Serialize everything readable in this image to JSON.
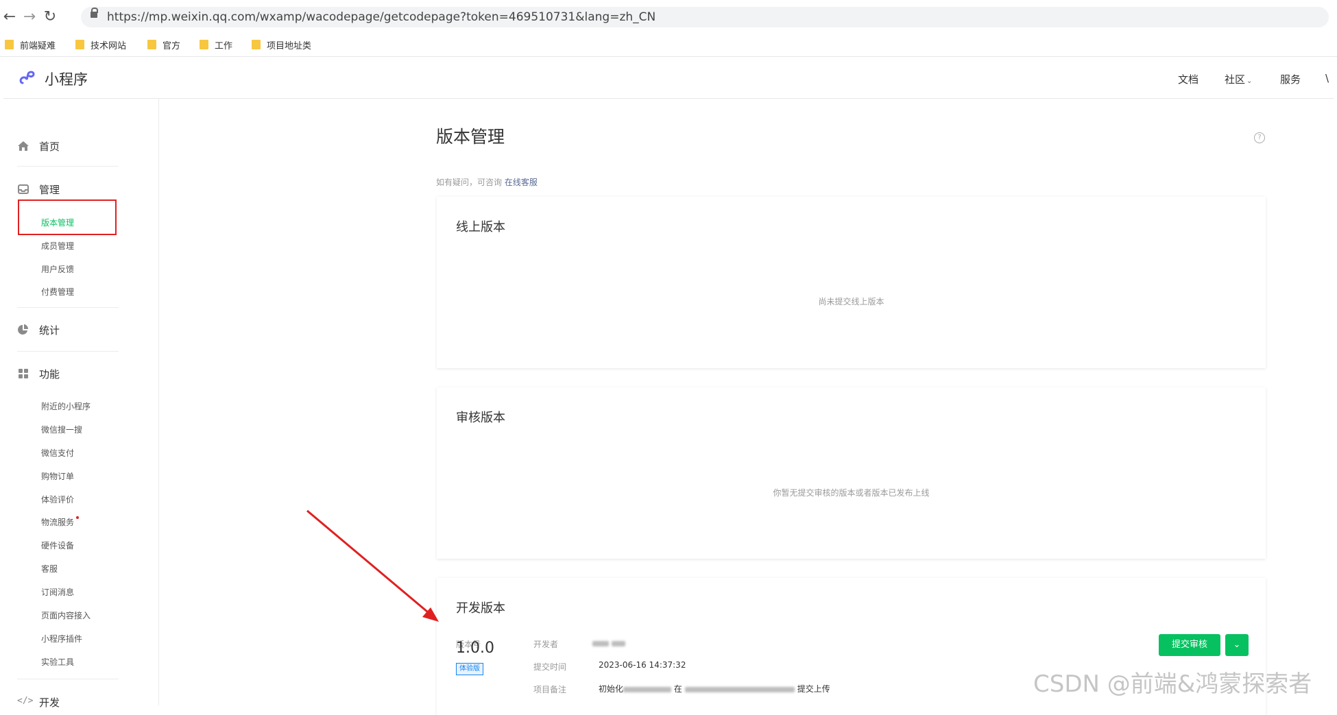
{
  "browser": {
    "url": "https://mp.weixin.qq.com/wxamp/wacodepage/getcodepage?token=469510731&lang=zh_CN",
    "bookmarks": [
      "前端疑难",
      "技术网站",
      "官方",
      "工作",
      "项目地址类"
    ]
  },
  "header": {
    "brand": "小程序",
    "nav": [
      "文档",
      "社区",
      "服务",
      "\\"
    ]
  },
  "sidebar": {
    "home": "首页",
    "manage": {
      "label": "管理",
      "items": [
        "版本管理",
        "成员管理",
        "用户反馈",
        "付费管理"
      ]
    },
    "stats": "统计",
    "features": {
      "label": "功能",
      "items": [
        "附近的小程序",
        "微信搜一搜",
        "微信支付",
        "购物订单",
        "体验评价",
        "物流服务",
        "硬件设备",
        "客服",
        "订阅消息",
        "页面内容接入",
        "小程序插件",
        "实验工具"
      ]
    },
    "dev": "开发"
  },
  "main": {
    "title": "版本管理",
    "tip_text": "如有疑问，可咨询",
    "tip_link": "在线客服",
    "online": {
      "title": "线上版本",
      "empty": "尚未提交线上版本"
    },
    "review": {
      "title": "审核版本",
      "empty": "你暂无提交审核的版本或者版本已发布上线"
    },
    "dev": {
      "title": "开发版本",
      "version_label": "版本号",
      "version": "1.0.0",
      "tag": "体验版",
      "developer_label": "开发者",
      "time_label": "提交时间",
      "time": "2023-06-16 14:37:32",
      "note_label": "项目备注",
      "note_prefix": "初始化",
      "note_mid": "在",
      "note_suffix": "提交上传",
      "submit": "提交审核"
    }
  },
  "watermark": "CSDN @前端&鸿蒙探索者",
  "colors": {
    "accent": "#07c160",
    "annotation": "#e02020",
    "link": "#576b95"
  }
}
